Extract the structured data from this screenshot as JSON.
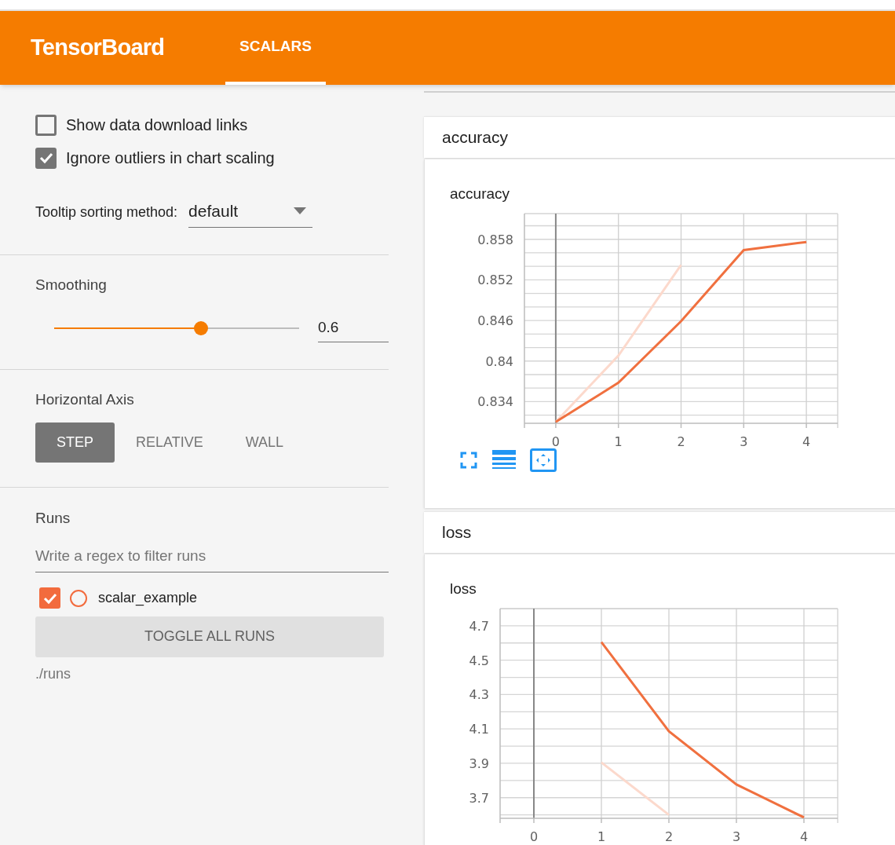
{
  "header": {
    "title": "TensorBoard",
    "tabs": [
      {
        "label": "SCALARS",
        "selected": true
      }
    ]
  },
  "sidebar": {
    "options": [
      {
        "label": "Show data download links",
        "checked": false
      },
      {
        "label": "Ignore outliers in chart scaling",
        "checked": true
      }
    ],
    "tooltip_sorting": {
      "label": "Tooltip sorting method:",
      "value": "default"
    },
    "smoothing": {
      "label": "Smoothing",
      "level": 0.6,
      "value": "0.6"
    },
    "horizontal_axis": {
      "label": "Horizontal Axis",
      "options": [
        {
          "label": "STEP",
          "selected": true
        },
        {
          "label": "RELATIVE",
          "selected": false
        },
        {
          "label": "WALL",
          "selected": false
        }
      ]
    },
    "runs": {
      "label": "Runs",
      "filter": {
        "placeholder": "Write a regex to filter runs"
      },
      "items": [
        {
          "name": "scalar_example",
          "checked": true,
          "color": "#f26b3d"
        }
      ],
      "toggle_button": "TOGGLE ALL RUNS",
      "directory": "./runs"
    }
  },
  "cards": [
    {
      "title": "accuracy",
      "chart_data": {
        "type": "line",
        "title": "accuracy",
        "x": [
          0,
          1,
          2,
          3,
          4
        ],
        "series": [
          {
            "color": "#fcd9cc",
            "values": [
              0.831,
              0.8408,
              0.8542,
              null,
              null
            ]
          },
          {
            "color": "#f0703f",
            "values": [
              0.831,
              0.8368,
              0.8459,
              0.8564,
              0.8576
            ]
          }
        ],
        "xlim": [
          -0.5,
          4.5
        ],
        "ylim": [
          0.8308,
          0.8618
        ],
        "xticks": [
          0,
          1,
          2,
          3,
          4
        ],
        "yticks": [
          0.834,
          {
            "value": 0.84,
            "label": "0.84"
          },
          0.846,
          0.852,
          0.858
        ],
        "grid": true
      }
    },
    {
      "title": "loss",
      "chart_data": {
        "type": "line",
        "title": "loss",
        "x": [
          1,
          2,
          3,
          4
        ],
        "series": [
          {
            "color": "#fcd9cc",
            "values": [
              3.905,
              3.6,
              null,
              null
            ]
          },
          {
            "color": "#f0703f",
            "values": [
              4.605,
              4.086,
              3.777,
              3.585
            ]
          }
        ],
        "xlim": [
          -0.5,
          4.5
        ],
        "ylim": [
          3.58,
          4.8
        ],
        "xticks": [
          0,
          1,
          2,
          3,
          4
        ],
        "yticks": [
          3.7,
          3.9,
          4.1,
          4.3,
          4.5,
          4.7
        ],
        "grid": true
      }
    }
  ]
}
